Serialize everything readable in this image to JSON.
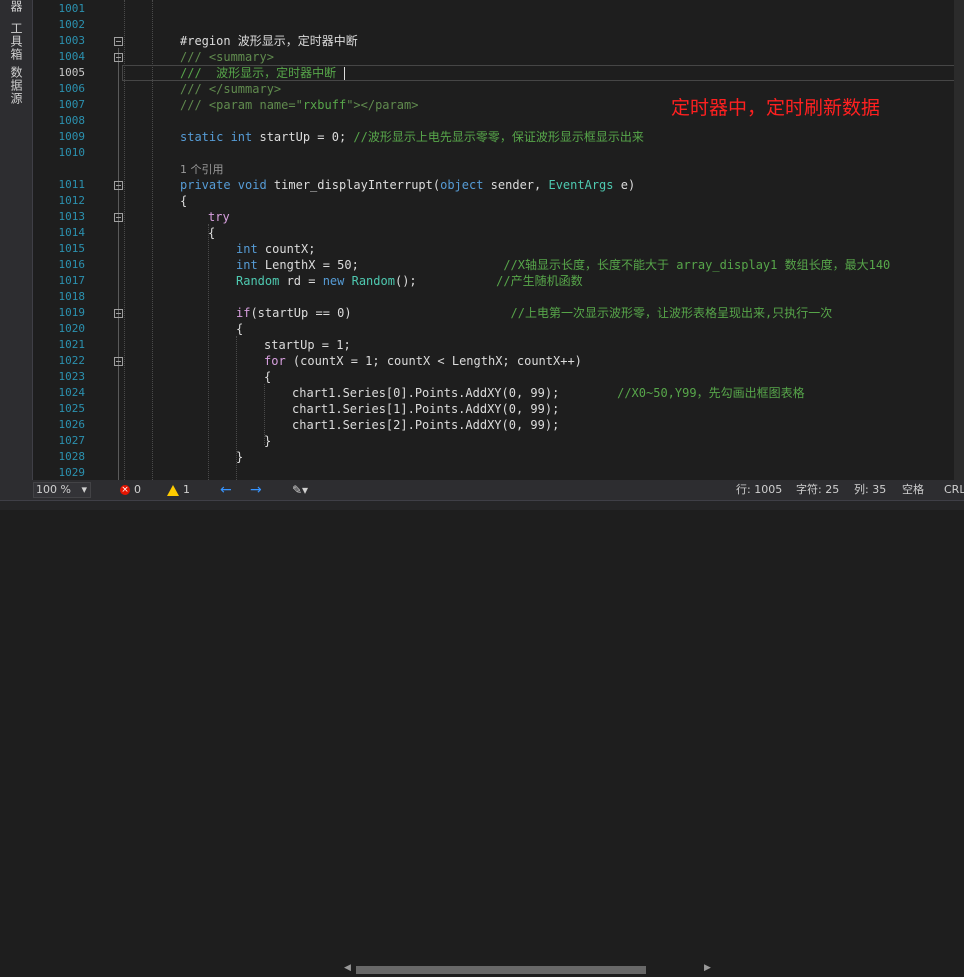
{
  "side_tabs": [
    {
      "label": "器"
    },
    {
      "label": "工具箱"
    },
    {
      "label": "数据源"
    }
  ],
  "annotation": "定时器中，定时刷新数据",
  "editor": {
    "lines": [
      {
        "num": "1001",
        "fold": false,
        "text": []
      },
      {
        "num": "1002",
        "fold": false,
        "text": []
      },
      {
        "num": "1003",
        "fold": true,
        "indent": 180,
        "text": [
          {
            "t": "#region 波形显示，定时器中断",
            "c": "pre"
          }
        ]
      },
      {
        "num": "1004",
        "fold": true,
        "indent": 180,
        "text": [
          {
            "t": "/// ",
            "c": "cmtg"
          },
          {
            "t": "<summary>",
            "c": "cmtg"
          }
        ]
      },
      {
        "num": "1005",
        "fold": false,
        "indent": 180,
        "cur": true,
        "text": [
          {
            "t": "///  波形显示，定时器中断 ",
            "c": "cmt"
          }
        ]
      },
      {
        "num": "1006",
        "fold": false,
        "indent": 180,
        "text": [
          {
            "t": "/// ",
            "c": "cmtg"
          },
          {
            "t": "</summary>",
            "c": "cmtg"
          }
        ]
      },
      {
        "num": "1007",
        "fold": false,
        "indent": 180,
        "text": [
          {
            "t": "/// ",
            "c": "cmtg"
          },
          {
            "t": "<param name=\"",
            "c": "cmtg"
          },
          {
            "t": "rxbuff",
            "c": "cmt"
          },
          {
            "t": "\"></param>",
            "c": "cmtg"
          }
        ]
      },
      {
        "num": "1008",
        "fold": false,
        "text": []
      },
      {
        "num": "1009",
        "fold": false,
        "indent": 180,
        "text": [
          {
            "t": "static int ",
            "c": "kw"
          },
          {
            "t": "startUp = 0; ",
            "c": "id"
          },
          {
            "t": "//波形显示上电先显示零零，保证波形显示框显示出来",
            "c": "cmt"
          }
        ]
      },
      {
        "num": "1010",
        "fold": false,
        "text": []
      },
      {
        "num": "",
        "fold": false,
        "indent": 180,
        "ref": true,
        "text": [
          {
            "t": "1 个引用",
            "c": "ref"
          }
        ]
      },
      {
        "num": "1011",
        "fold": true,
        "indent": 180,
        "text": [
          {
            "t": "private void ",
            "c": "kw"
          },
          {
            "t": "timer_displayInterrupt(",
            "c": "id"
          },
          {
            "t": "object ",
            "c": "kw"
          },
          {
            "t": "sender, ",
            "c": "id"
          },
          {
            "t": "EventArgs ",
            "c": "type"
          },
          {
            "t": "e)",
            "c": "id"
          }
        ]
      },
      {
        "num": "1012",
        "fold": false,
        "indent": 180,
        "text": [
          {
            "t": "{",
            "c": "id"
          }
        ]
      },
      {
        "num": "1013",
        "fold": true,
        "indent": 208,
        "text": [
          {
            "t": "try",
            "c": "ctl"
          }
        ]
      },
      {
        "num": "1014",
        "fold": false,
        "indent": 208,
        "text": [
          {
            "t": "{",
            "c": "id"
          }
        ]
      },
      {
        "num": "1015",
        "fold": false,
        "indent": 236,
        "text": [
          {
            "t": "int ",
            "c": "kw"
          },
          {
            "t": "countX;",
            "c": "id"
          }
        ]
      },
      {
        "num": "1016",
        "fold": false,
        "indent": 236,
        "text": [
          {
            "t": "int ",
            "c": "kw"
          },
          {
            "t": "LengthX = 50;                    ",
            "c": "id"
          },
          {
            "t": "//X轴显示长度，长度不能大于 array_display1 数组长度，最大140",
            "c": "cmt"
          }
        ]
      },
      {
        "num": "1017",
        "fold": false,
        "indent": 236,
        "text": [
          {
            "t": "Random ",
            "c": "type"
          },
          {
            "t": "rd = ",
            "c": "id"
          },
          {
            "t": "new ",
            "c": "kw"
          },
          {
            "t": "Random",
            "c": "type"
          },
          {
            "t": "();           ",
            "c": "id"
          },
          {
            "t": "//产生随机函数",
            "c": "cmt"
          }
        ]
      },
      {
        "num": "1018",
        "fold": false,
        "text": []
      },
      {
        "num": "1019",
        "fold": true,
        "indent": 236,
        "text": [
          {
            "t": "if",
            "c": "ctl"
          },
          {
            "t": "(startUp == 0)                      ",
            "c": "id"
          },
          {
            "t": "//上电第一次显示波形零，让波形表格呈现出来,只执行一次",
            "c": "cmt"
          }
        ]
      },
      {
        "num": "1020",
        "fold": false,
        "indent": 236,
        "text": [
          {
            "t": "{",
            "c": "id"
          }
        ]
      },
      {
        "num": "1021",
        "fold": false,
        "indent": 264,
        "text": [
          {
            "t": "startUp = 1;",
            "c": "id"
          }
        ]
      },
      {
        "num": "1022",
        "fold": true,
        "indent": 264,
        "text": [
          {
            "t": "for ",
            "c": "ctl"
          },
          {
            "t": "(countX = 1; countX < LengthX; countX++)",
            "c": "id"
          }
        ]
      },
      {
        "num": "1023",
        "fold": false,
        "indent": 264,
        "text": [
          {
            "t": "{",
            "c": "id"
          }
        ]
      },
      {
        "num": "1024",
        "fold": false,
        "indent": 292,
        "text": [
          {
            "t": "chart1.Series[0].Points.AddXY(0, 99);        ",
            "c": "id"
          },
          {
            "t": "//X0~50,Y99，先勾画出框图表格",
            "c": "cmt"
          }
        ]
      },
      {
        "num": "1025",
        "fold": false,
        "indent": 292,
        "text": [
          {
            "t": "chart1.Series[1].Points.AddXY(0, 99);",
            "c": "id"
          }
        ]
      },
      {
        "num": "1026",
        "fold": false,
        "indent": 292,
        "text": [
          {
            "t": "chart1.Series[2].Points.AddXY(0, 99);",
            "c": "id"
          }
        ]
      },
      {
        "num": "1027",
        "fold": false,
        "indent": 264,
        "text": [
          {
            "t": "}",
            "c": "id"
          }
        ]
      },
      {
        "num": "1028",
        "fold": false,
        "indent": 236,
        "text": [
          {
            "t": "}",
            "c": "id"
          }
        ]
      },
      {
        "num": "1029",
        "fold": false,
        "text": []
      }
    ]
  },
  "status": {
    "zoom": "100 %",
    "errors": "0",
    "warnings": "1",
    "line": "行: 1005",
    "char": "字符: 25",
    "col": "列: 35",
    "spaces": "空格",
    "eol": "CRL"
  },
  "colors": {
    "accent": "#007acc",
    "error": "#e51400",
    "warning": "#ffcc00",
    "annotation": "#ff2020"
  }
}
